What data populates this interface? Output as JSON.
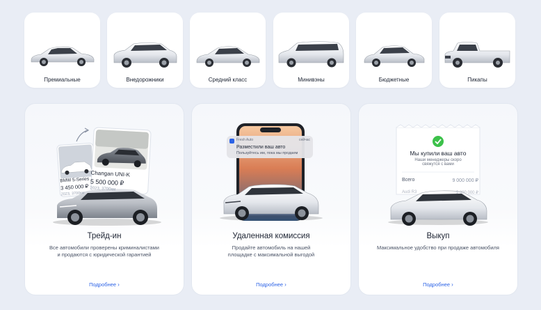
{
  "categories": [
    {
      "label": "Премиальные",
      "icon": "sedan-car-icon"
    },
    {
      "label": "Внедорожники",
      "icon": "suv-car-icon"
    },
    {
      "label": "Средний класс",
      "icon": "midsize-sedan-icon"
    },
    {
      "label": "Минивэны",
      "icon": "minivan-icon"
    },
    {
      "label": "Бюджетные",
      "icon": "budget-sedan-icon"
    },
    {
      "label": "Пикапы",
      "icon": "pickup-truck-icon"
    }
  ],
  "services": [
    {
      "title": "Трейд-ин",
      "description_line1": "Все автомобили проверены криминалистами",
      "description_line2": "и продаются с юридической гарантией",
      "more": "Подробнее",
      "cards": {
        "back": {
          "name": "BMW 5-Series",
          "price": "3 450 000 ₽",
          "meta": "2023, 3700км"
        },
        "front": {
          "name": "Changan UNI-K",
          "price": "5 500 000 ₽",
          "meta": "2023, 3700км"
        }
      }
    },
    {
      "title": "Удаленная комиссия",
      "description_line1": "Продайте автомобиль на нашей",
      "description_line2": "площадке с максимальной выгодой",
      "more": "Подробнее",
      "notification": {
        "app": "Fresh Auto",
        "time": "сейчас",
        "title": "Разместили ваш авто",
        "body": "Пользуйтесь им, пока мы продаем"
      }
    },
    {
      "title": "Выкуп",
      "description_line1": "Максимальное удобство при продаже автомобиля",
      "description_line2": "",
      "more": "Подробнее",
      "receipt": {
        "title": "Мы купили ваш авто",
        "subtitle_line1": "Наши менеджеры скоро",
        "subtitle_line2": "свяжутся с вами",
        "total_label": "Всего",
        "total_value": "9 000 000 ₽",
        "item_label": "Audi R3",
        "item_value": "9 000 000 ₽"
      }
    }
  ],
  "colors": {
    "accent": "#2c63e6",
    "success": "#3cc14a",
    "background": "#e9edf5"
  }
}
